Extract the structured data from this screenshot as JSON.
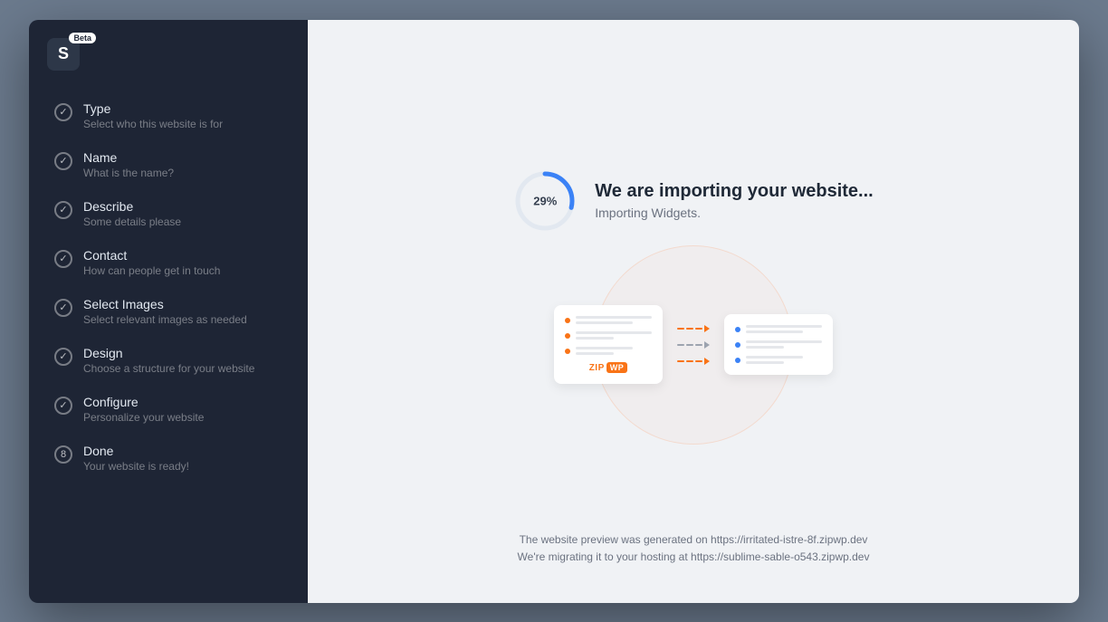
{
  "app": {
    "logo_letter": "S",
    "beta_label": "Beta"
  },
  "sidebar": {
    "steps": [
      {
        "id": 1,
        "title": "Type",
        "subtitle": "Select who this website is for",
        "status": "completed",
        "icon": "check"
      },
      {
        "id": 2,
        "title": "Name",
        "subtitle": "What is the name?",
        "status": "completed",
        "icon": "check"
      },
      {
        "id": 3,
        "title": "Describe",
        "subtitle": "Some details please",
        "status": "completed",
        "icon": "check"
      },
      {
        "id": 4,
        "title": "Contact",
        "subtitle": "How can people get in touch",
        "status": "completed",
        "icon": "check"
      },
      {
        "id": 5,
        "title": "Select Images",
        "subtitle": "Select relevant images as needed",
        "status": "completed",
        "icon": "check"
      },
      {
        "id": 6,
        "title": "Design",
        "subtitle": "Choose a structure for your website",
        "status": "completed",
        "icon": "check"
      },
      {
        "id": 7,
        "title": "Configure",
        "subtitle": "Personalize your website",
        "status": "completed",
        "icon": "check"
      },
      {
        "id": 8,
        "title": "Done",
        "subtitle": "Your website is ready!",
        "status": "number",
        "icon": "8"
      }
    ]
  },
  "main": {
    "progress_percent": "29%",
    "import_title": "We are importing your website...",
    "import_subtitle": "Importing Widgets.",
    "bottom_line1": "The website preview was generated on https://irritated-istre-8f.zipwp.dev",
    "bottom_line2": "We're migrating it to your hosting at https://sublime-sable-o543.zipwp.dev",
    "zip_label": "ZIP",
    "zip_badge": "WP"
  }
}
